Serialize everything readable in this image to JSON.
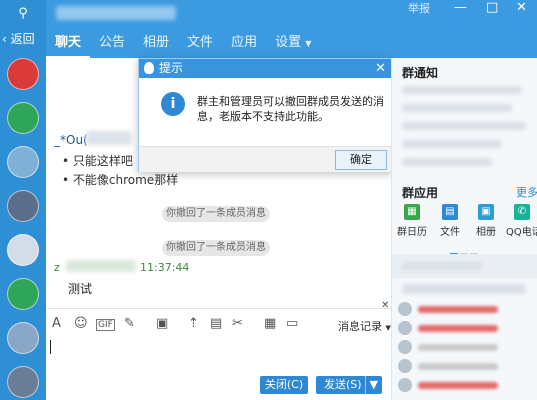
{
  "sidebar": {
    "back_label": "返回",
    "search_icon": "magnifier",
    "avatar_colors": [
      "#d93b3b",
      "#2fa55a",
      "#7fb1d6",
      "#5c6e8a",
      "#d3dde8",
      "#2fa55a",
      "#8aa7c7",
      "#6b7d96",
      "#e5b07a",
      "#9bb5cf"
    ]
  },
  "header": {
    "report_label": "举报",
    "tabs": [
      "聊天",
      "公告",
      "相册",
      "文件",
      "应用",
      "设置"
    ],
    "active_tab": 0
  },
  "chat": {
    "sender1": "_*Ou(",
    "msg1_lines": [
      "只能这样吧",
      "不能像chrome那样"
    ],
    "recall_notices": [
      "你撤回了一条成员消息",
      "你撤回了一条成员消息"
    ],
    "sender2": "z",
    "time2": "11:37:44",
    "msg2": "测试"
  },
  "dialog": {
    "title": "提示",
    "message": "群主和管理员可以撤回群成员发送的消息，老版本不支持此功能。",
    "ok_label": "确定"
  },
  "toolbar": {
    "history_label": "消息记录",
    "close_label": "关闭(C)",
    "send_label": "发送(S)"
  },
  "right_panel": {
    "notice_title": "群通知",
    "apps_title": "群应用",
    "more_label": "更多",
    "apps": [
      {
        "label": "群日历",
        "color": "#3aa64a",
        "icon": "calendar-icon"
      },
      {
        "label": "文件",
        "color": "#2f88d4",
        "icon": "folder-icon"
      },
      {
        "label": "相册",
        "color": "#2a9fd6",
        "icon": "photo-icon"
      },
      {
        "label": "QQ电话",
        "color": "#18b39a",
        "icon": "phone-icon"
      }
    ],
    "member_name_colors": [
      "#e36a6a",
      "#e36a6a",
      "#c9c9c9",
      "#c9c9c9",
      "#c9c9c9",
      "#e36a6a",
      "#e36a6a"
    ]
  }
}
